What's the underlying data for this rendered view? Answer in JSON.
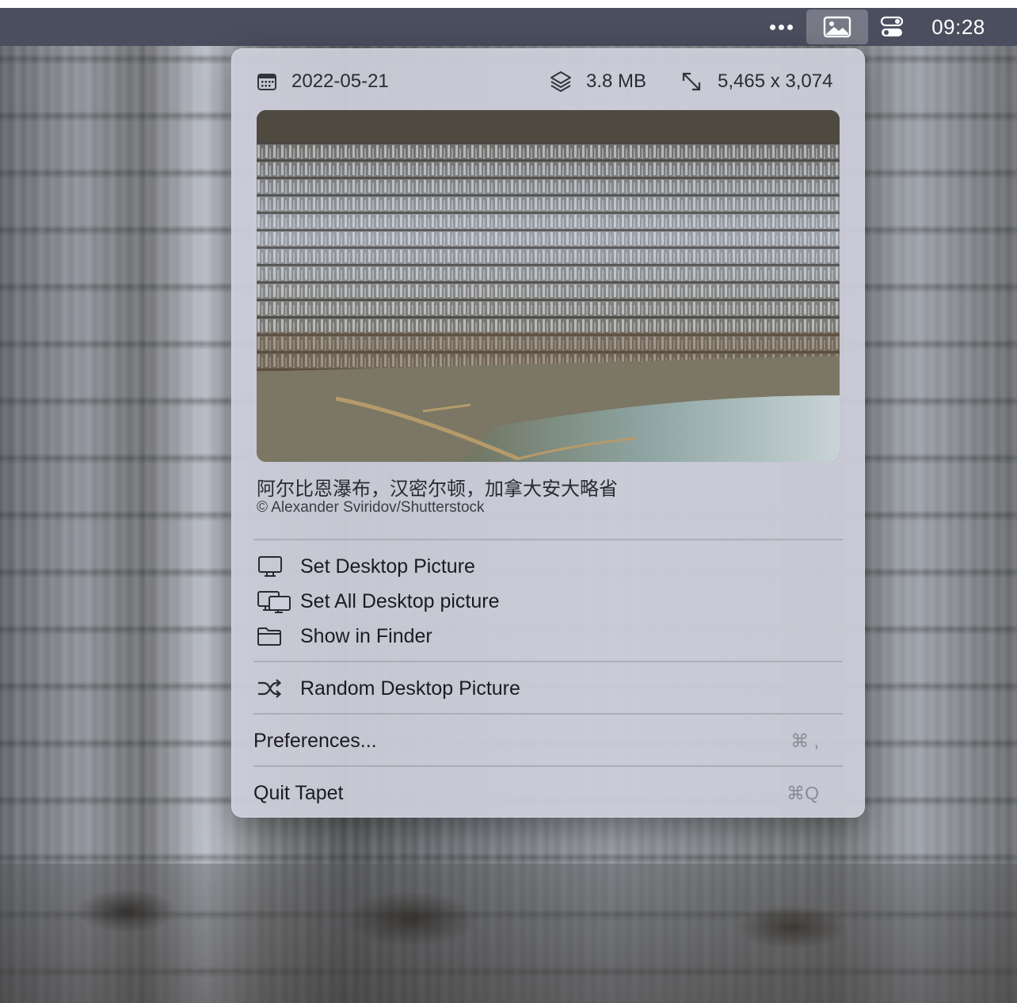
{
  "menubar": {
    "more_icon": "ellipsis-icon",
    "app_icon": "photo-icon",
    "control_icon": "control-center-icon",
    "clock": "09:28"
  },
  "popover": {
    "meta": {
      "date": "2022-05-21",
      "size": "3.8 MB",
      "dimensions": "5,465 x 3,074"
    },
    "caption": {
      "title": "阿尔比恩瀑布，汉密尔顿，加拿大安大略省",
      "credit": "© Alexander Sviridov/Shutterstock"
    },
    "actions": [
      {
        "label": "Set Desktop Picture",
        "icon": "display-icon"
      },
      {
        "label": "Set All Desktop picture",
        "icon": "multiple-displays-icon"
      },
      {
        "label": "Show in Finder",
        "icon": "folder-icon"
      }
    ],
    "random": {
      "label": "Random Desktop Picture",
      "icon": "shuffle-icon"
    },
    "preferences": {
      "label": "Preferences...",
      "shortcut": "⌘ ,"
    },
    "quit": {
      "label": "Quit Tapet",
      "shortcut": "⌘Q"
    }
  }
}
